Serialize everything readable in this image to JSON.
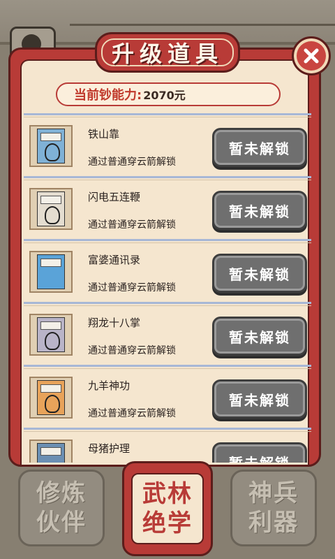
{
  "dialog": {
    "title": "升级道具",
    "money_label": "当前钞能力:",
    "money_value": "2070元"
  },
  "items": [
    {
      "name": "铁山靠",
      "requirement": "通过普通穿云箭解锁",
      "button": "暂未解锁",
      "cover_color": "#7fb1d6",
      "cover_label": "铁山靠"
    },
    {
      "name": "闪电五连鞭",
      "requirement": "通过普通穿云箭解锁",
      "button": "暂未解锁",
      "cover_color": "#e4ddd0",
      "cover_label": "闪电五连鞭"
    },
    {
      "name": "富婆通讯录",
      "requirement": "通过普通穿云箭解锁",
      "button": "暂未解锁",
      "cover_color": "#5aa3d8",
      "cover_label": "富婆通讯录"
    },
    {
      "name": "翔龙十八掌",
      "requirement": "通过普通穿云箭解锁",
      "button": "暂未解锁",
      "cover_color": "#b9b4c8",
      "cover_label": "翔龙十八掌"
    },
    {
      "name": "九羊神功",
      "requirement": "通过普通穿云箭解锁",
      "button": "暂未解锁",
      "cover_color": "#e8a35a",
      "cover_label": "九羊神功"
    },
    {
      "name": "母猪护理",
      "requirement": "",
      "button": "暂未解锁",
      "cover_color": "#6b8fb3",
      "cover_label": "母猪护理"
    }
  ],
  "tabs": [
    {
      "label_line1": "修炼",
      "label_line2": "伙伴",
      "active": false
    },
    {
      "label_line1": "武林",
      "label_line2": "绝学",
      "active": true
    },
    {
      "label_line1": "神兵",
      "label_line2": "利器",
      "active": false
    }
  ],
  "icons": {
    "close": "close-icon"
  }
}
